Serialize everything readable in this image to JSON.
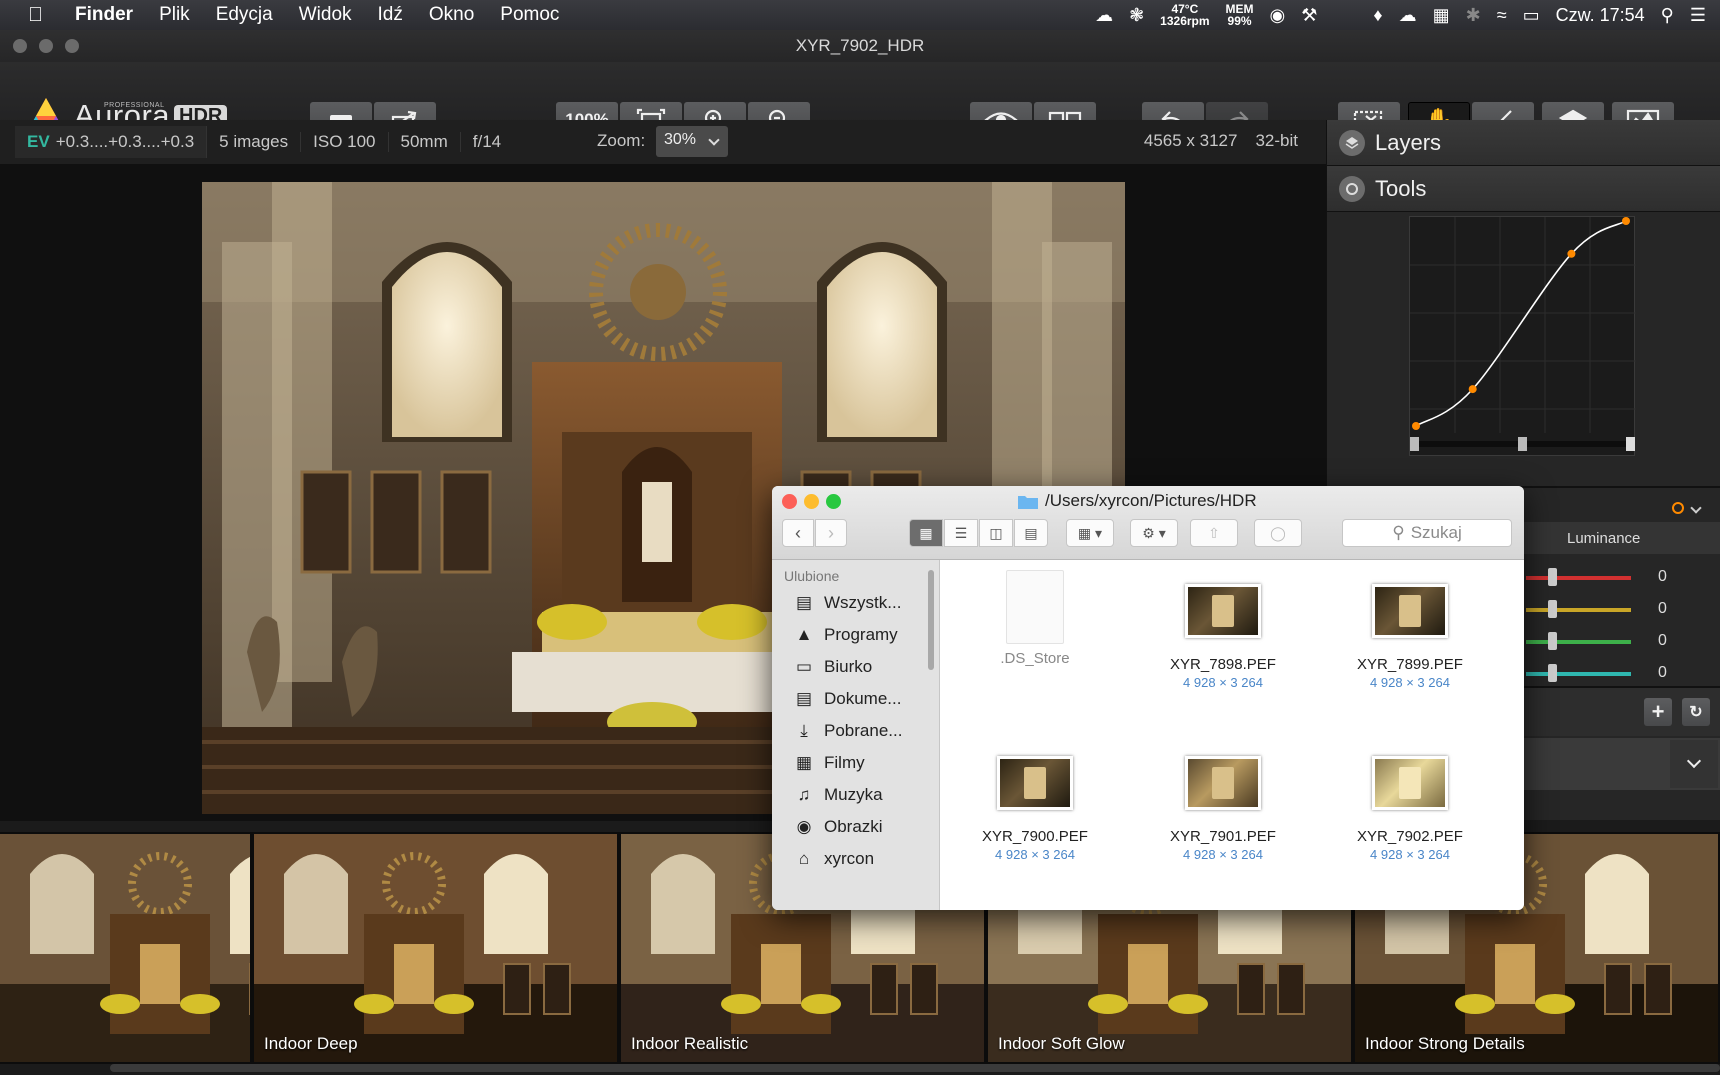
{
  "menubar": {
    "app": "Finder",
    "items": [
      "Plik",
      "Edycja",
      "Widok",
      "Idź",
      "Okno",
      "Pomoc"
    ],
    "status": {
      "temp": "47°C",
      "rpm": "1326rpm",
      "mem_label": "MEM",
      "mem": "99%",
      "clock": "Czw. 17:54"
    }
  },
  "window": {
    "title": "XYR_7902_HDR"
  },
  "app": {
    "logo_pro": "PROFESSIONAL",
    "logo": "Aurora",
    "logo_hdr": "HDR"
  },
  "toolbar": {
    "zoom": "100%"
  },
  "infobar": {
    "ev_label": "EV",
    "ev_value": "+0.3....+0.3....+0.3",
    "images": "5 images",
    "iso": "ISO 100",
    "focal": "50mm",
    "aperture": "f/14",
    "zoom_label": "Zoom:",
    "zoom_value": "30%",
    "dimensions": "4565 x 3127",
    "bitdepth": "32-bit"
  },
  "panel": {
    "layers": "Layers",
    "tools": "Tools",
    "luminance": "Luminance",
    "slider_values": [
      "0",
      "0",
      "0",
      "0"
    ],
    "curve_points": [
      [
        0,
        0
      ],
      [
        0.27,
        0.18
      ],
      [
        0.74,
        0.84
      ],
      [
        1,
        1
      ]
    ]
  },
  "presets": [
    {
      "label": ""
    },
    {
      "label": "Indoor Deep"
    },
    {
      "label": "Indoor Realistic"
    },
    {
      "label": "Indoor Soft Glow"
    },
    {
      "label": "Indoor Strong Details"
    }
  ],
  "finder": {
    "path": "/Users/xyrcon/Pictures/HDR",
    "search_placeholder": "Szukaj",
    "sidebar_header": "Ulubione",
    "sidebar": [
      "Wszystk...",
      "Programy",
      "Biurko",
      "Dokume...",
      "Pobrane...",
      "Filmy",
      "Muzyka",
      "Obrazki",
      "xyrcon"
    ],
    "files": [
      {
        "name": ".DS_Store",
        "size": ""
      },
      {
        "name": "XYR_7898.PEF",
        "size": "4 928 × 3 264"
      },
      {
        "name": "XYR_7899.PEF",
        "size": "4 928 × 3 264"
      },
      {
        "name": "XYR_7900.PEF",
        "size": "4 928 × 3 264"
      },
      {
        "name": "XYR_7901.PEF",
        "size": "4 928 × 3 264"
      },
      {
        "name": "XYR_7902.PEF",
        "size": "4 928 × 3 264"
      }
    ]
  }
}
